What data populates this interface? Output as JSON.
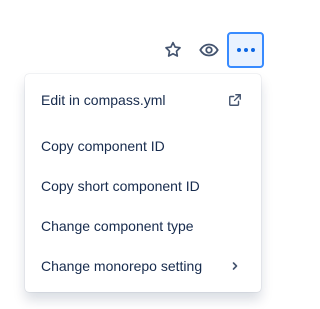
{
  "header": {
    "actions": [
      {
        "icon": "star-icon"
      },
      {
        "icon": "eye-icon"
      },
      {
        "icon": "more-icon"
      }
    ]
  },
  "menu": {
    "items": [
      {
        "label": "Edit in compass.yml",
        "icon": "external-link-icon"
      },
      {
        "label": "Copy component ID"
      },
      {
        "label": "Copy short component ID"
      },
      {
        "label": "Change component type"
      },
      {
        "label": "Change monorepo setting",
        "icon": "chevron-right-icon"
      }
    ]
  },
  "colors": {
    "text": "#172b4d",
    "icon": "#44546f",
    "accent": "#0c66e4",
    "accent_border": "#388bff",
    "accent_bg": "#e9f2ff"
  }
}
